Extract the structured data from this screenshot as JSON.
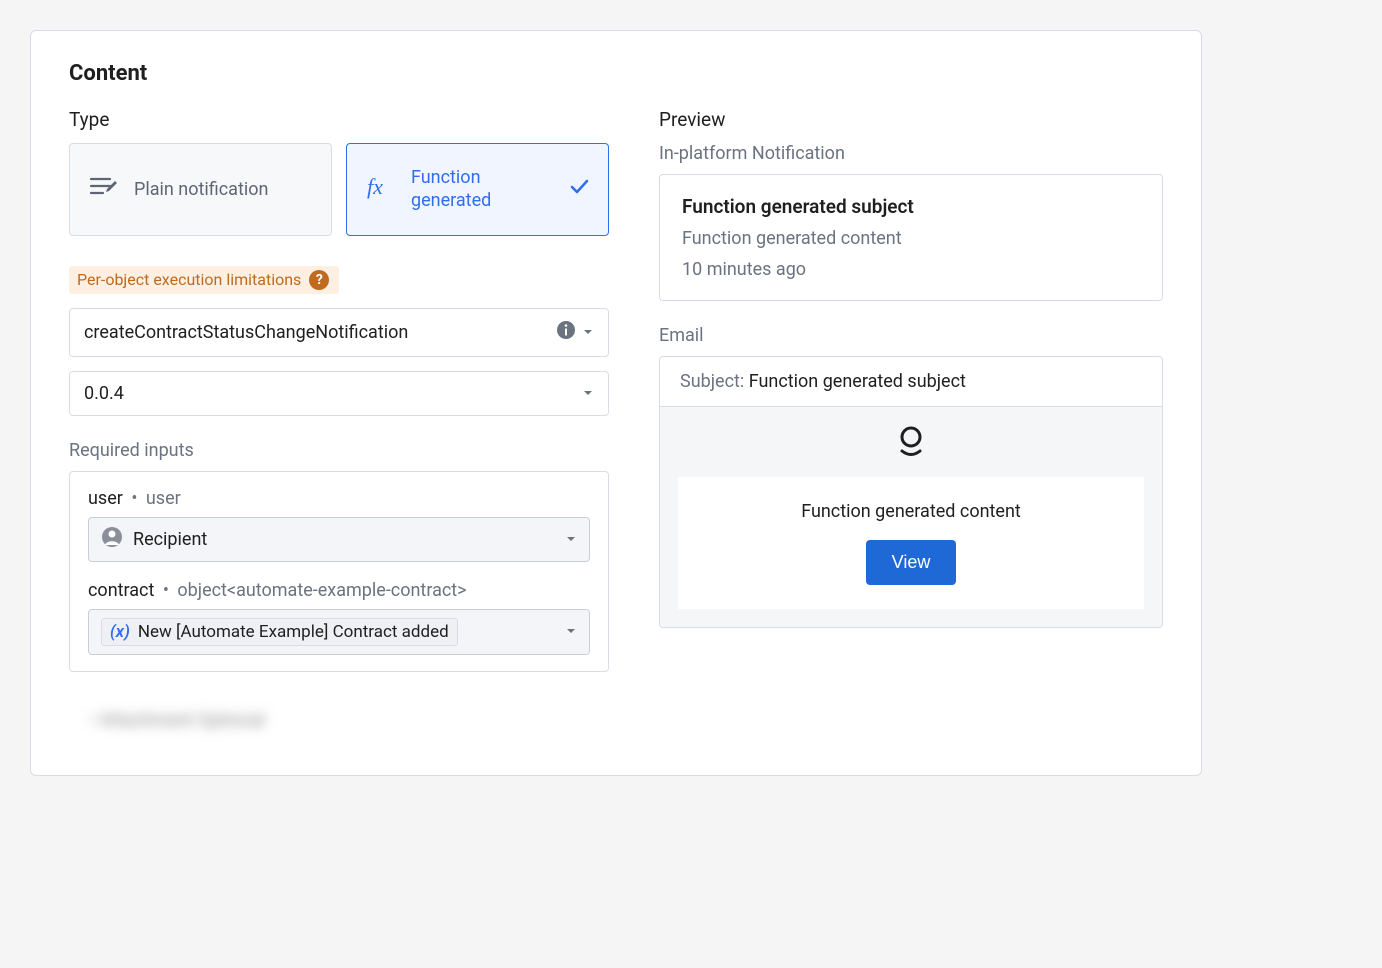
{
  "panel": {
    "title": "Content"
  },
  "type": {
    "label": "Type",
    "plain": "Plain notification",
    "fn": "Function generated"
  },
  "warning": {
    "label": "Per-object execution limitations"
  },
  "function_select": {
    "value": "createContractStatusChangeNotification"
  },
  "version_select": {
    "value": "0.0.4"
  },
  "required": {
    "label": "Required inputs",
    "inputs": [
      {
        "name": "user",
        "type": "user",
        "value": "Recipient"
      },
      {
        "name": "contract",
        "type": "object<automate-example-contract>",
        "value": "New [Automate Example] Contract added"
      }
    ]
  },
  "blurred_text": "•  Attachment Optional",
  "preview": {
    "label": "Preview",
    "in_platform_label": "In-platform Notification",
    "subject": "Function generated subject",
    "content": "Function generated content",
    "time": "10 minutes ago",
    "email_label": "Email",
    "email_subject_label": "Subject:",
    "email_subject_value": "Function generated subject",
    "email_content": "Function generated content",
    "view_button": "View"
  }
}
